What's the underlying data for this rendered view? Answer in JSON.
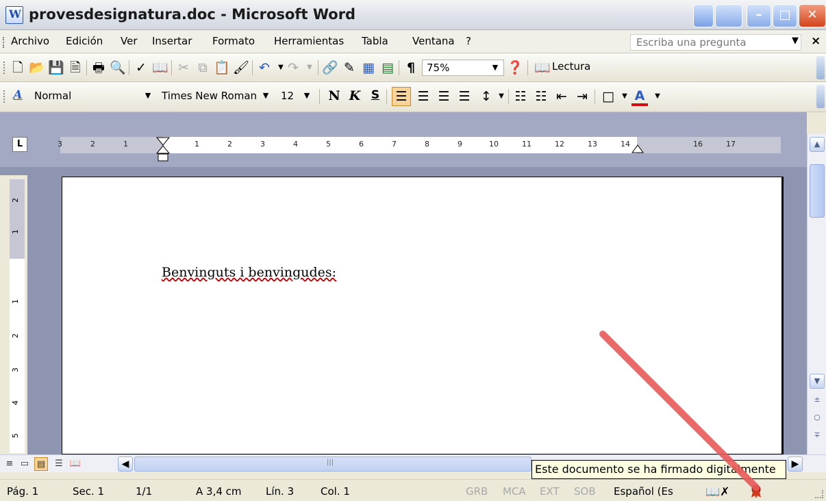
{
  "window": {
    "title": "provesdesignatura.doc - Microsoft Word",
    "buttons": {
      "minimize": "–",
      "maximize": "□",
      "close": "✕"
    }
  },
  "menu": {
    "items": [
      {
        "label": "Archivo"
      },
      {
        "label": "Edición"
      },
      {
        "label": "Ver"
      },
      {
        "label": "Insertar"
      },
      {
        "label": "Formato"
      },
      {
        "label": "Herramientas"
      },
      {
        "label": "Tabla"
      },
      {
        "label": "Ventana"
      },
      {
        "label": "?"
      }
    ],
    "ask_placeholder": "Escriba una pregunta",
    "close_glyph": "×"
  },
  "standard_toolbar": {
    "zoom": "75%",
    "lectura_label": "Lectura",
    "icons": [
      "new-icon",
      "open-icon",
      "save-icon",
      "permission-icon",
      "print-icon",
      "print-preview-icon",
      "spelling-icon",
      "research-icon",
      "cut-icon",
      "copy-icon",
      "paste-icon",
      "format-painter-icon",
      "undo-icon",
      "redo-icon",
      "hyperlink-icon",
      "tables-borders-icon",
      "insert-table-icon",
      "insert-excel-icon",
      "show-formatting-icon",
      "help-icon",
      "read-icon"
    ]
  },
  "format_toolbar": {
    "style": "Normal",
    "font": "Times New Roman",
    "size": "12",
    "bold_label": "N",
    "italic_label": "K",
    "underline_label": "S",
    "active_align": "left"
  },
  "ruler": {
    "labels": [
      "3",
      "2",
      "1",
      "1",
      "2",
      "3",
      "4",
      "5",
      "6",
      "7",
      "8",
      "9",
      "10",
      "11",
      "12",
      "13",
      "14",
      "16",
      "17"
    ],
    "vertical_labels": [
      "2",
      "1",
      "1",
      "2",
      "3",
      "4",
      "5"
    ]
  },
  "document": {
    "text": "Benvinguts i benvingudes:"
  },
  "tooltip": {
    "text": "Este documento se ha firmado digitalmente"
  },
  "status": {
    "page": "Pág. 1",
    "section": "Sec. 1",
    "pages": "1/1",
    "at": "A 3,4 cm",
    "line": "Lín. 3",
    "col": "Col. 1",
    "grb": "GRB",
    "mca": "MCA",
    "ext": "EXT",
    "sob": "SOB",
    "language": "Español (Es"
  },
  "colors": {
    "annotation_arrow": "#e85a5a",
    "workspace": "#8e95b0",
    "active_button": "#f8d49a"
  }
}
